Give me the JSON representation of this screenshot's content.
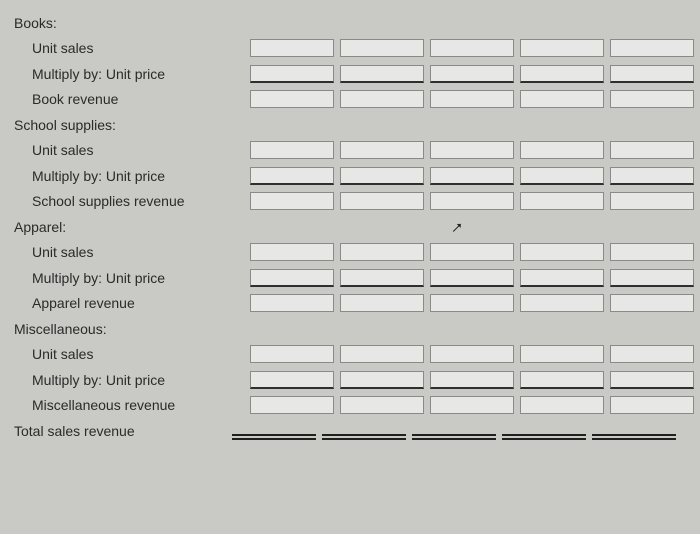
{
  "sections": [
    {
      "header": "Books:",
      "rows": [
        {
          "label": "Unit sales",
          "kind": "plain"
        },
        {
          "label": "Multiply by: Unit price",
          "kind": "mul"
        },
        {
          "label": "Book revenue",
          "kind": "plain"
        }
      ]
    },
    {
      "header": "School supplies:",
      "rows": [
        {
          "label": "Unit sales",
          "kind": "plain"
        },
        {
          "label": "Multiply by: Unit price",
          "kind": "mul"
        },
        {
          "label": "School supplies revenue",
          "kind": "plain"
        }
      ]
    },
    {
      "header": "Apparel:",
      "rows": [
        {
          "label": "Unit sales",
          "kind": "plain"
        },
        {
          "label": "Multiply by: Unit price",
          "kind": "mul"
        },
        {
          "label": "Apparel revenue",
          "kind": "plain"
        }
      ]
    },
    {
      "header": "Miscellaneous:",
      "rows": [
        {
          "label": "Unit sales",
          "kind": "plain"
        },
        {
          "label": "Multiply by: Unit price",
          "kind": "mul"
        },
        {
          "label": "Miscellaneous revenue",
          "kind": "plain"
        }
      ]
    }
  ],
  "total_label": "Total sales revenue",
  "columns": 5,
  "cell_values": {
    "all_empty": true
  }
}
